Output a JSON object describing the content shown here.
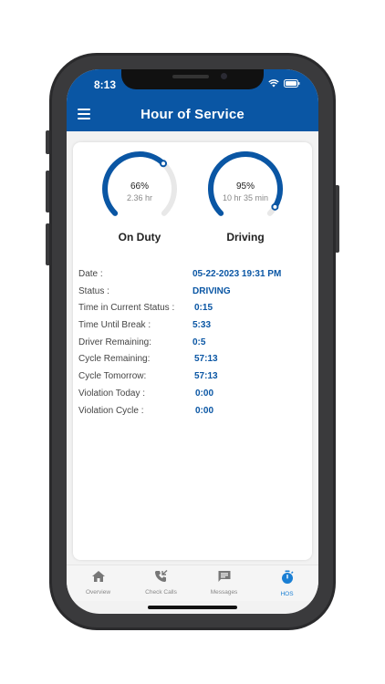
{
  "status_bar": {
    "time": "8:13"
  },
  "header": {
    "title": "Hour of Service"
  },
  "gauges": [
    {
      "percent": "66%",
      "fraction": 0.66,
      "sub": "2.36 hr",
      "label": "On Duty"
    },
    {
      "percent": "95%",
      "fraction": 0.95,
      "sub": "10 hr 35 min",
      "label": "Driving"
    }
  ],
  "details": [
    {
      "label": "Date :",
      "value": "05-22-2023 19:31 PM"
    },
    {
      "label": "Status :",
      "value": "DRIVING"
    },
    {
      "label": "Time in Current Status :",
      "value": "0:15"
    },
    {
      "label": "Time Until Break :",
      "value": "5:33"
    },
    {
      "label": "Driver Remaining:",
      "value": "0:5"
    },
    {
      "label": "Cycle Remaining:",
      "value": "57:13"
    },
    {
      "label": "Cycle Tomorrow:",
      "value": "57:13"
    },
    {
      "label": "Violation Today :",
      "value": "0:00"
    },
    {
      "label": "Violation Cycle :",
      "value": "0:00"
    }
  ],
  "tabs": [
    {
      "label": "Overview",
      "icon": "home-icon"
    },
    {
      "label": "Check Calls",
      "icon": "phone-icon"
    },
    {
      "label": "Messages",
      "icon": "message-icon"
    },
    {
      "label": "HOS",
      "icon": "stopwatch-icon",
      "active": true
    }
  ],
  "colors": {
    "brand": "#0a56a4",
    "gauge_track": "#e8e8e8",
    "active_tab": "#1a7fd4"
  }
}
